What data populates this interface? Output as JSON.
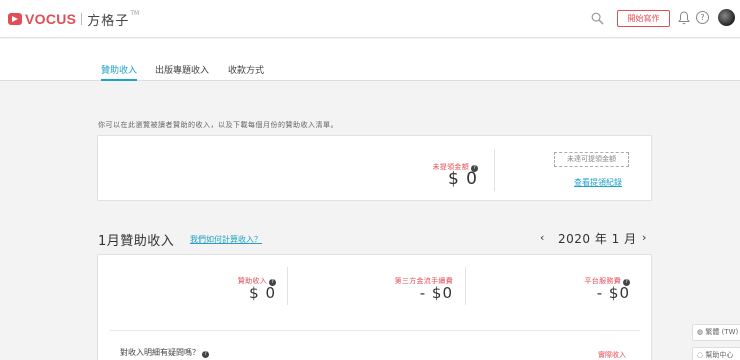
{
  "header": {
    "brand": "VOCUS",
    "brand_sub": "方格子",
    "brand_tm": "TM",
    "write_button": "開始寫作",
    "help_glyph": "?"
  },
  "tabs": [
    {
      "label": "贊助收入",
      "active": true
    },
    {
      "label": "出版專題收入",
      "active": false
    },
    {
      "label": "收款方式",
      "active": false
    }
  ],
  "intro_text": "你可以在此瀏覽被讀者贊助的收入，以及下載每個月份的贊助收入清單。",
  "withdraw_card": {
    "unwithdrawn_label": "未提領金額",
    "unwithdrawn_amount": "$ 0",
    "threshold_box": "未達可提領金額",
    "history_link": "查看提領紀錄"
  },
  "month_section": {
    "title": "1月贊助收入",
    "how_link": "我們如何計算收入？",
    "prev_arrow": "‹",
    "date": "2020 年 1 月",
    "next_arrow": "›"
  },
  "stats": [
    {
      "label": "贊助收入",
      "amount": "$ 0"
    },
    {
      "label": "第三方金流手續費",
      "amount": "- $0"
    },
    {
      "label": "平台服務費",
      "amount": "- $0"
    }
  ],
  "question_text": "對收入明細有疑問嗎？",
  "net_income_label": "實際收入",
  "side_buttons": [
    {
      "label": "繁體 (TW)"
    },
    {
      "label": "幫助中心"
    }
  ],
  "colors": {
    "accent": "#1fa1c8",
    "brand": "#e34d55"
  }
}
